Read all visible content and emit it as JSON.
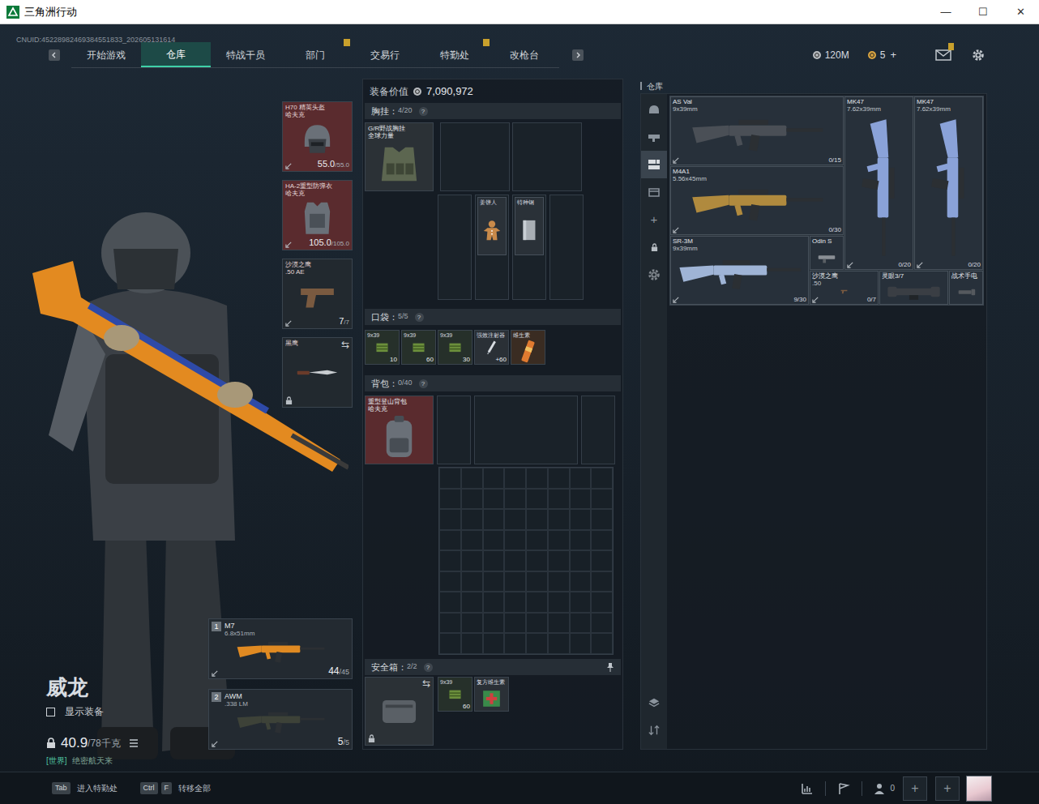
{
  "window": {
    "title": "三角洲行动",
    "controls": [
      "—",
      "☐",
      "✕"
    ]
  },
  "uid": "CNUID:45228982469384551833_202605131614",
  "nav": {
    "tabs": [
      {
        "label": "开始游戏",
        "selected": false,
        "badge": false
      },
      {
        "label": "仓库",
        "selected": true,
        "badge": false
      },
      {
        "label": "特战干员",
        "selected": false,
        "badge": false
      },
      {
        "label": "部门",
        "selected": false,
        "badge": true
      },
      {
        "label": "交易行",
        "selected": false,
        "badge": false
      },
      {
        "label": "特勤处",
        "selected": false,
        "badge": true
      },
      {
        "label": "改枪台",
        "selected": false,
        "badge": false
      }
    ],
    "currencies": [
      {
        "amount": "120M",
        "color": "#b8bcc0"
      },
      {
        "amount": "5",
        "color": "#d9a441"
      }
    ],
    "add": "+",
    "mail_badge": true
  },
  "operator": {
    "name": "威龙",
    "show_equipment": {
      "label": "显示装备",
      "checked": false
    },
    "weight": "40.9",
    "weight_max": "/78千克",
    "chat": {
      "channel": "[世界]",
      "message": "绝密航天来"
    }
  },
  "gear": [
    {
      "kind": "helmet",
      "name": "H70 精英头盔",
      "brand": "哈夫克",
      "value": "55.0",
      "max": "/55.0",
      "color": "#5a2b2e"
    },
    {
      "kind": "armor",
      "name": "HA-2重型防弹衣",
      "brand": "哈夫克",
      "value": "105.0",
      "max": "/105.0",
      "color": "#5a2b2e"
    },
    {
      "kind": "pistol",
      "name": "沙漠之鹰",
      "brand": ".50 AE",
      "value": "7",
      "max": "/7",
      "color": "#22292f"
    },
    {
      "kind": "melee",
      "name": "黑鹰",
      "swap": "⇆",
      "locked": true,
      "color": "#22292f"
    }
  ],
  "weapons": [
    {
      "slot": "1",
      "name": "M7",
      "caliber": "6.8x51mm",
      "ammo": "44",
      "max": "/45",
      "color": "#e08a22"
    },
    {
      "slot": "2",
      "name": "AWM",
      "caliber": ".338 LM",
      "ammo": "5",
      "max": "/5",
      "color": "#3d4238"
    }
  ],
  "loadout": {
    "value_label": "装备价值",
    "value": "7,090,972",
    "chest": {
      "label": "胸挂：",
      "count": "4/20",
      "help": "?",
      "rig": {
        "name": "G/R野战胸挂",
        "brand": "全球力量"
      },
      "containers": [
        {
          "contents": []
        },
        {
          "contents": []
        },
        {
          "contents": []
        },
        {
          "contents": [
            {
              "name": "姜饼人",
              "kind": "gingerbread"
            }
          ]
        },
        {
          "contents": [
            {
              "name": "特种钢",
              "kind": "steel"
            }
          ]
        },
        {
          "contents": []
        }
      ]
    },
    "pockets": {
      "label": "口袋：",
      "count": "5/5",
      "help": "?",
      "items": [
        {
          "name": "9x39",
          "qty": "10",
          "kind": "ammo",
          "color": "#26302a"
        },
        {
          "name": "9x39",
          "qty": "60",
          "kind": "ammo",
          "color": "#26302a"
        },
        {
          "name": "9x39",
          "qty": "30",
          "kind": "ammo",
          "color": "#26302a"
        },
        {
          "name": "强效注射器",
          "qty": "+60",
          "kind": "injector",
          "color": "#2a3036"
        },
        {
          "name": "维生素",
          "kind": "vitamin",
          "color": "#3a2c22"
        }
      ]
    },
    "backpack": {
      "label": "背包：",
      "count": "0/40",
      "help": "?",
      "bag": {
        "name": "重型登山背包",
        "brand": "哈夫克"
      }
    },
    "safe": {
      "label": "安全箱：",
      "count": "2/2",
      "help": "?",
      "swap": "⇆",
      "locked": true,
      "items": [
        {
          "name": "9x39",
          "qty": "60",
          "kind": "ammo",
          "color": "#26302a"
        },
        {
          "name": "复方维生素",
          "kind": "medkit",
          "color": "#2a3036"
        }
      ]
    }
  },
  "warehouse": {
    "title": "仓库",
    "tabs": [
      {
        "selected": false
      },
      {
        "selected": false
      },
      {
        "selected": true
      },
      {
        "selected": false
      }
    ],
    "add": "+",
    "items": [
      {
        "name": "AS Val",
        "caliber": "9x39mm",
        "ammo": "0/15",
        "kind": "rifle",
        "color": "#4a4f56"
      },
      {
        "name": "MK47",
        "caliber": "7.62x39mm",
        "ammo": "0/20",
        "kind": "rifle-v",
        "color": "#8aa2d8"
      },
      {
        "name": "MK47",
        "caliber": "7.62x39mm",
        "ammo": "0/20",
        "kind": "rifle-v",
        "color": "#8aa2d8"
      },
      {
        "name": "M4A1",
        "caliber": "5.56x45mm",
        "ammo": "0/30",
        "kind": "rifle",
        "color": "#b08a3e"
      },
      {
        "name": "SR-3M",
        "caliber": "9x39mm",
        "ammo": "9/30",
        "kind": "rifle",
        "color": "#9fb4d6"
      },
      {
        "name": "Odin S",
        "kind": "attachment",
        "color": "#8a8f95"
      },
      {
        "name": "沙漠之鹰",
        "caliber": ".50",
        "ammo": "0/7",
        "kind": "pistol",
        "color": "#7a5a40"
      },
      {
        "name": "灵眼3/7",
        "kind": "scope",
        "color": "#3a3e44"
      },
      {
        "name": "战术手电",
        "kind": "flashlight",
        "color": "#55595e"
      }
    ]
  },
  "footer": {
    "hints": [
      {
        "keys": [
          "Tab"
        ],
        "label": "进入特勤处"
      },
      {
        "keys": [
          "Ctrl",
          "F"
        ],
        "label": "转移全部"
      }
    ],
    "friends": "0",
    "slots": [
      "+",
      "+"
    ]
  }
}
